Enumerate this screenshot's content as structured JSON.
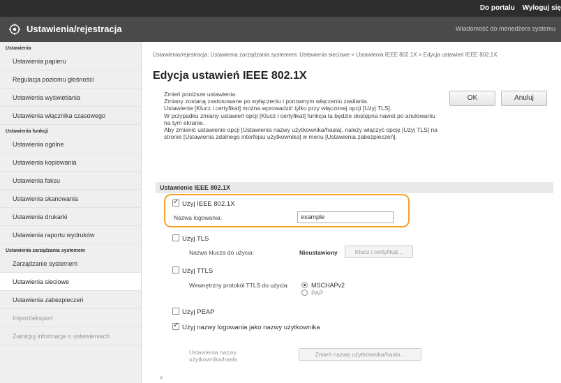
{
  "topbar": {
    "links": [
      "Do portalu",
      "Wyloguj się"
    ]
  },
  "header": {
    "title": "Ustawienia/rejestracja",
    "message": "Wiadomość do menedżera systemu"
  },
  "sidebar": {
    "groups": [
      {
        "heading": "Ustawienia",
        "items": [
          "Ustawienia papieru",
          "Regulacja poziomu głośności",
          "Ustawienia wyświetlania",
          "Ustawienia włącznika czasowego"
        ]
      },
      {
        "heading": "Ustawienia funkcji",
        "items": [
          "Ustawienia ogólne",
          "Ustawienia kopiowania",
          "Ustawienia faksu",
          "Ustawienia skanowania",
          "Ustawienia drukarki",
          "Ustawienia raportu wydruków"
        ]
      },
      {
        "heading": "Ustawienia zarządzania systemem",
        "items": [
          "Zarządzanie systemem",
          "Ustawienia sieciowe",
          "Ustawienia zabezpieczeń",
          "Import/eksport",
          "Zainicjuj informacje o ustawieniach"
        ]
      }
    ]
  },
  "main": {
    "breadcrumb": "Ustawienia/rejestracja: Ustawienia zarządzania systemem: Ustawienia sieciowe > Ustawienia IEEE 802.1X > Edycja ustawień IEEE 802.1X",
    "title": "Edycja ustawień IEEE 802.1X",
    "ok_label": "OK",
    "cancel_label": "Anuluj",
    "intro": [
      "Zmień poniższe ustawienia.",
      "Zmiany zostaną zastosowane po wyłączeniu i ponownym włączeniu zasilania.",
      "Ustawienie [Klucz i certyfikat] można wprowadzić tylko przy włączonej opcji [Użyj TLS].",
      "W przypadku zmiany ustawień opcji [Klucz i certyfikat] funkcja ta będzie dostępna nawet po anulowaniu na tym ekranie.",
      "Aby zmienić ustawienie opcji [Ustawienia nazwy użytkownika/hasła], należy włączyć opcję [Użyj TLS] na stronie [Ustawienia zdalnego interfejsu użytkownika] w menu [Ustawienia zabezpieczeń]."
    ],
    "section_title": "Ustawienie IEEE 802.1X",
    "use_ieee_label": "Użyj IEEE 802.1X",
    "login_name_label": "Nazwa logowania:",
    "login_name_value": "example",
    "use_tls_label": "Użyj TLS",
    "key_name_label": "Nazwa klucza do użycia:",
    "key_name_value": "Nieustawiony",
    "key_cert_button": "Klucz i certyfikat...",
    "use_ttls_label": "Użyj TTLS",
    "ttls_protocol_label": "Wewnętrzny protokół TTLS do użycia:",
    "ttls_options": [
      "MSCHAPv2",
      "PAP"
    ],
    "use_peap_label": "Użyj PEAP",
    "use_login_as_user_label": "Użyj nazwy logowania jako nazwy użytkownika",
    "user_pass_settings_label": "Ustawienia nazwy użytkownika/hasła",
    "change_user_pass_button": "Zmień nazwę użytkownika/hasło...",
    "footer_mark": "x"
  },
  "colors": {
    "highlight": "#f3a32c",
    "titlebar": "#4a4a4a"
  }
}
